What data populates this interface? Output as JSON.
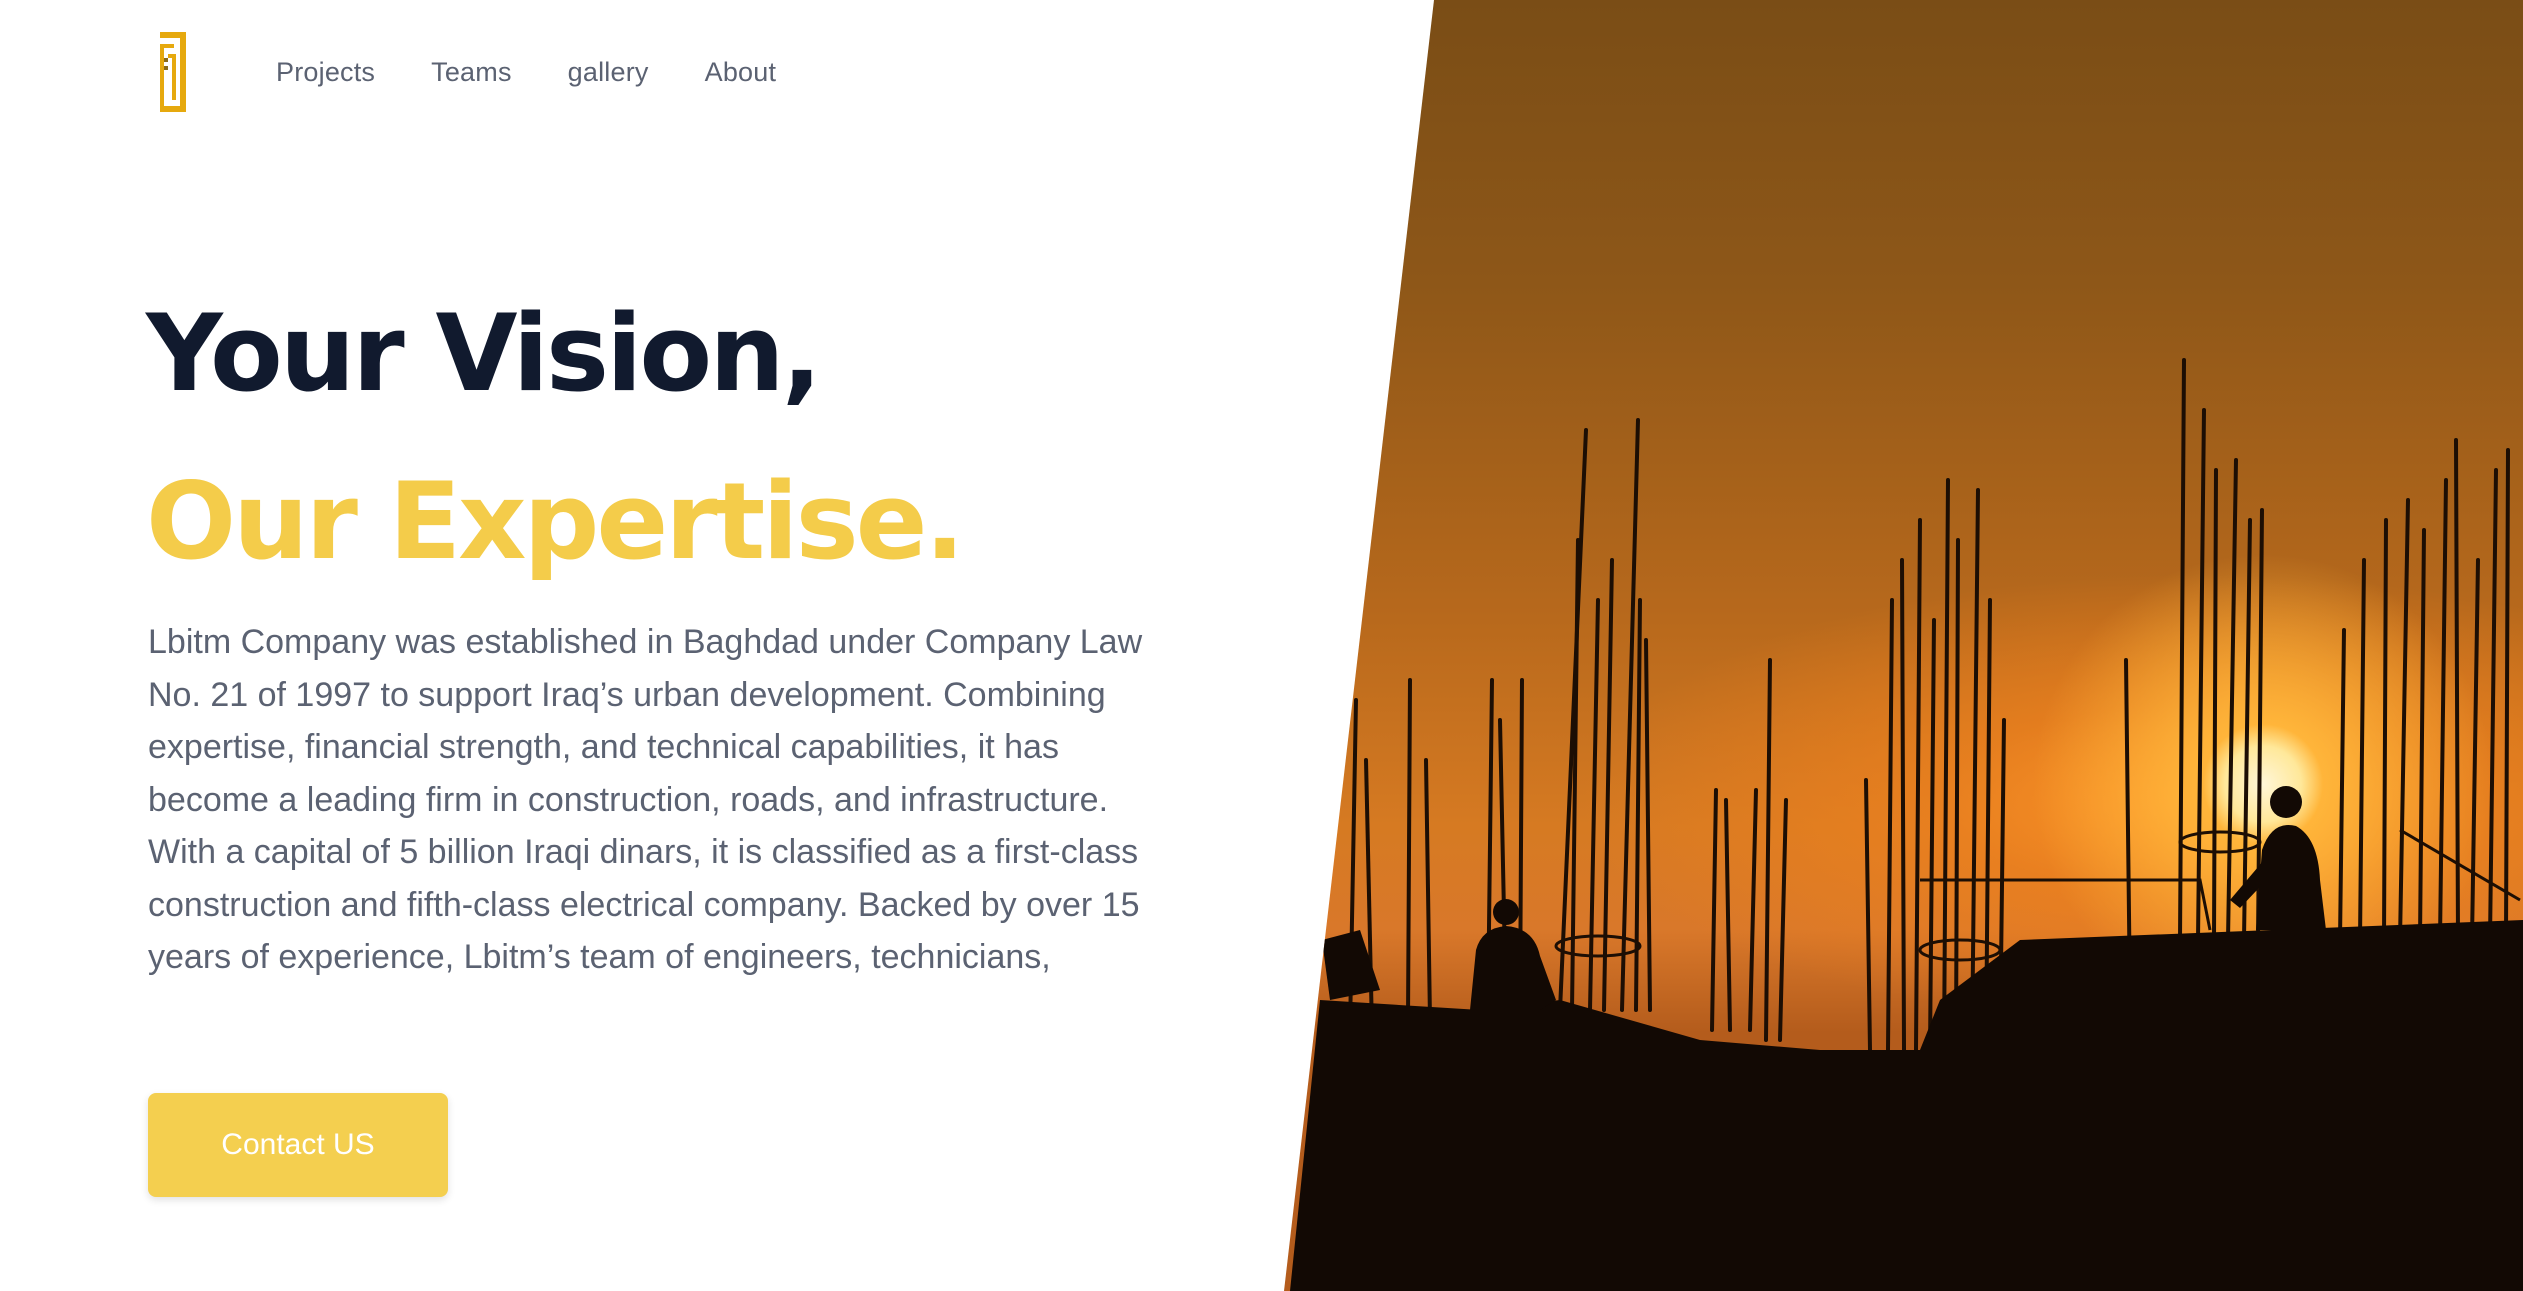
{
  "nav": {
    "logo_icon": "company-logo-icon",
    "items": [
      {
        "label": "Projects"
      },
      {
        "label": "Teams"
      },
      {
        "label": "gallery"
      },
      {
        "label": "About"
      }
    ]
  },
  "hero": {
    "headline_line1": "Your Vision,",
    "headline_line2": "Our Expertise.",
    "description": "Lbitm Company was established in Baghdad under Company Law No. 21 of 1997 to support Iraq’s urban development. Combining expertise, financial strength, and technical capabilities, it has become a leading firm in construction, roads, and infrastructure. With a capital of 5 billion Iraqi dinars, it is classified as a first-class construction and fifth-class electrical company. Backed by over 15 years of experience, Lbitm’s team of engineers, technicians,",
    "cta_label": "Contact US",
    "image": "construction-silhouette-sunset-image"
  },
  "colors": {
    "accent": "#f4cc4a",
    "heading": "#111a2e",
    "body_text": "#5b6272",
    "button": "#f4cf4f"
  }
}
